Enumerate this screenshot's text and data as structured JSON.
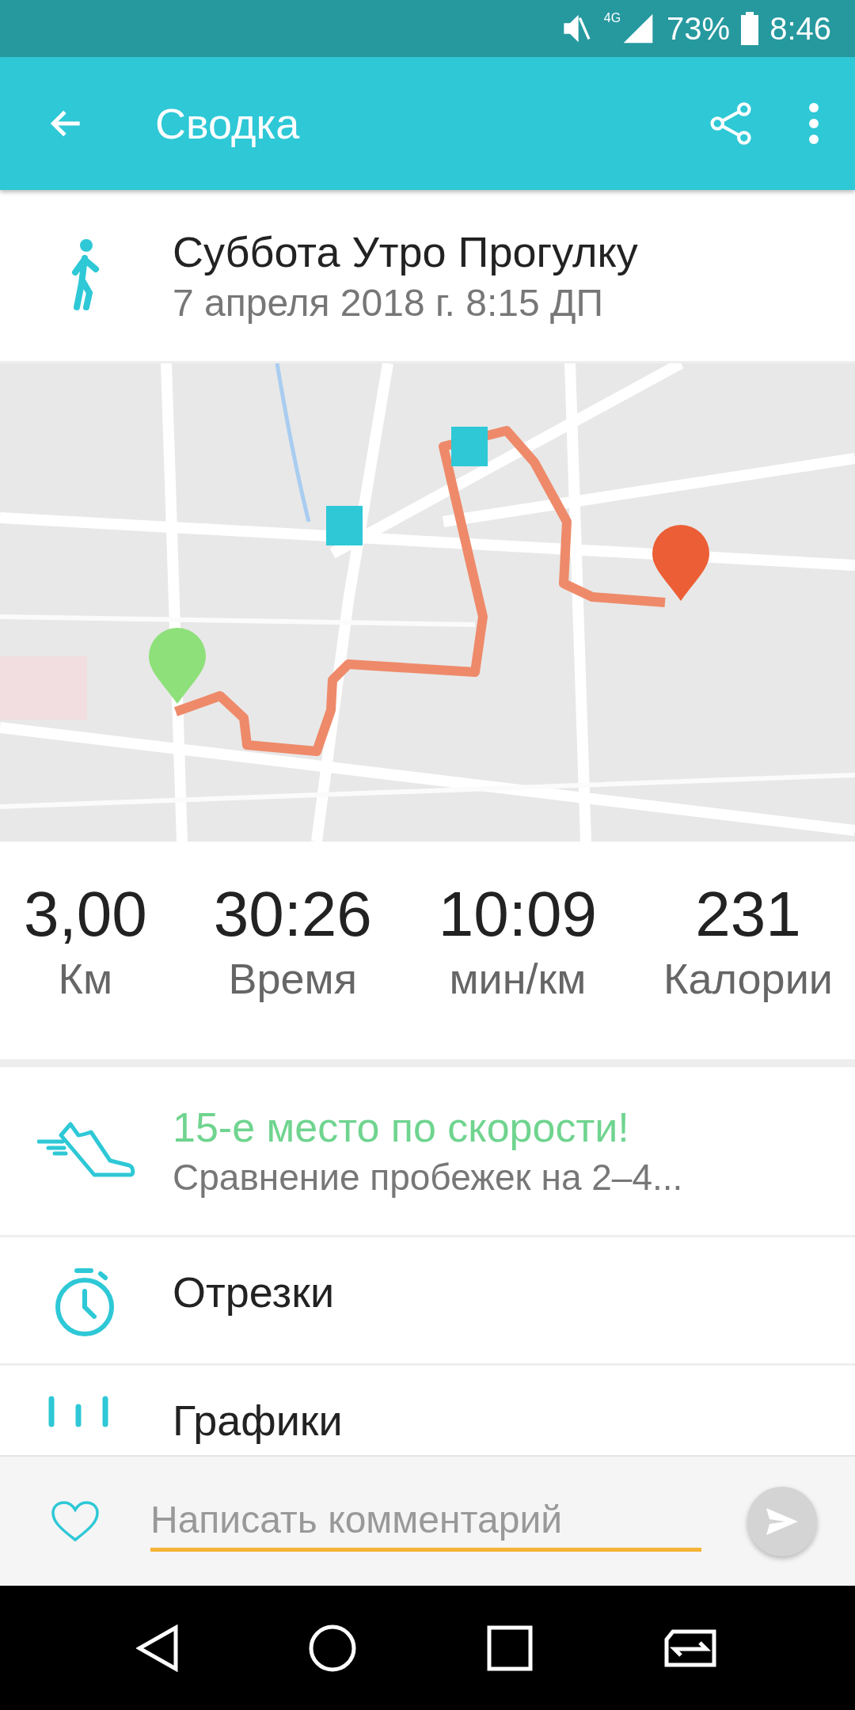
{
  "status_bar": {
    "network": "4G",
    "battery": "73%",
    "time": "8:46"
  },
  "app_bar": {
    "title": "Сводка"
  },
  "activity": {
    "title": "Суббота Утро Прогулку",
    "date": "7 апреля 2018 г. 8:15 ДП"
  },
  "stats": [
    {
      "value": "3,00",
      "label": "Км"
    },
    {
      "value": "30:26",
      "label": "Время"
    },
    {
      "value": "10:09",
      "label": "мин/км"
    },
    {
      "value": "231",
      "label": "Калории"
    }
  ],
  "achievement": {
    "title": "15-е место по скорости!",
    "subtitle": "Сравнение пробежек на 2–4..."
  },
  "sections": [
    {
      "kind": "splits",
      "label": "Отрезки"
    },
    {
      "kind": "charts",
      "label": "Графики"
    }
  ],
  "comment": {
    "placeholder": "Написать комментарий"
  }
}
